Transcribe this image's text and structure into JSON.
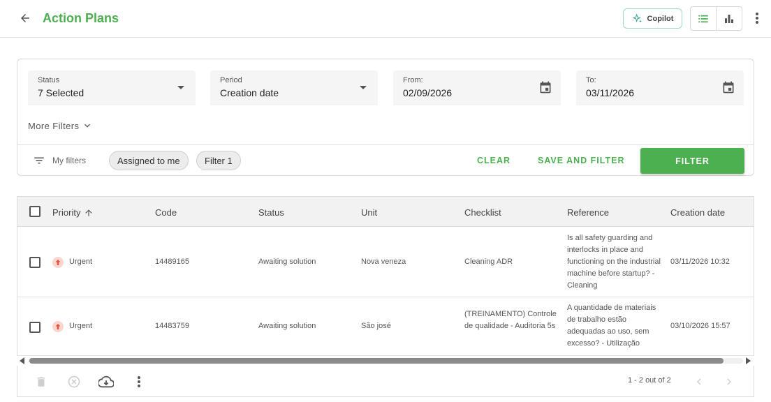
{
  "header": {
    "title": "Action Plans",
    "copilot_label": "Copilot",
    "accent_color": "#4caf50"
  },
  "filters": {
    "status": {
      "label": "Status",
      "value": "7 Selected"
    },
    "period": {
      "label": "Period",
      "value": "Creation date"
    },
    "from": {
      "label": "From:",
      "value": "02/09/2026"
    },
    "to": {
      "label": "To:",
      "value": "03/11/2026"
    },
    "more_filters": "More Filters",
    "my_filters": "My filters",
    "chips": [
      "Assigned to me",
      "Filter 1"
    ],
    "clear_label": "CLEAR",
    "save_filter_label": "SAVE AND FILTER",
    "filter_label": "FILTER"
  },
  "table": {
    "columns": [
      "Priority",
      "Code",
      "Status",
      "Unit",
      "Checklist",
      "Reference",
      "Creation date"
    ],
    "rows": [
      {
        "priority": "Urgent",
        "code": "14489165",
        "status": "Awaiting solution",
        "unit": "Nova veneza",
        "checklist": "Cleaning ADR",
        "reference": "Is all safety guarding and interlocks in place and functioning on the industrial machine before startup? - Cleaning",
        "created": "03/11/2026 10:32"
      },
      {
        "priority": "Urgent",
        "code": "14483759",
        "status": "Awaiting solution",
        "unit": "São josé",
        "checklist": "(TREINAMENTO) Controle de qualidade -  Auditoria 5s",
        "reference": "A quantidade de materiais de trabalho estão adequadas ao uso, sem excesso? - Utilização",
        "created": "03/10/2026 15:57"
      }
    ]
  },
  "footer": {
    "page_info": "1 - 2 out of 2"
  }
}
